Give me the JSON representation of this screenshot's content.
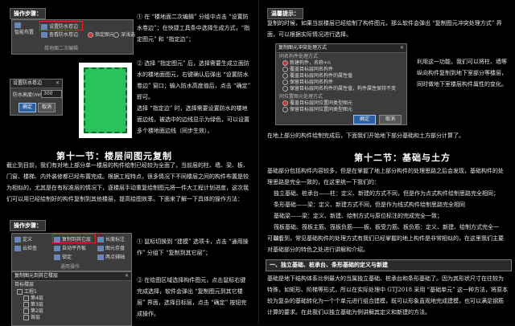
{
  "left": {
    "ops_header1": "操作步骤：",
    "toolbar1": {
      "btn_waterproof": "设置防水卷边",
      "btn_smart_layout": "智能布置",
      "btn_view_waterproof": "查看防水卷边",
      "chk_specify_element": "指定图元",
      "chk_select_ok": "深浅选",
      "group_label": "楼地面二次编辑"
    },
    "step1": "① 在 “楼地面二次编辑” 分组中点击 “设置防水卷边”；在快捷工具条中选择生成方式，“指定图元” 和 “指定边”；",
    "step2": "② 选择 “指定图元” 后，选择需要生成立面防水的楼地面图元，右键确认后弹出 “设置防水卷边” 窗口；输入防水高度值后，点击 “确定” 即可。",
    "step3": "选择 “指定边” 时，选择需要设置防水的楼地面边线，被选中的边线显示为绿色，可以设置多个楼地面边线（同步生效）。",
    "dialog1": {
      "title": "设置防水卷边",
      "label_height": "防水高度(mm)",
      "value": "300",
      "ok": "确定",
      "cancel": "取消"
    },
    "section11_title": "第十一节：楼层间图元复制",
    "section11_intro": "截止到目前，我们有对地上部分单一楼层的构件绘制已经较为全面了，当前层的柱、墙、梁、板、门窗、楼梯、内外装修都已经布置完成。根据工程特点，很多情况下不同楼层之间的构件布置是较为相似的，尤其是在有标准层的情况下，逐楼层手动重复绘制图元将一件大工程计划进度，这次我们可以用已经绘制好的构件复制到其他楼层，提高绘图效率。下面来了解一下具体的操作方法：",
    "ops_header2": "操作步骤：",
    "toolbar2": {
      "definition": "定义",
      "copy_to_layer": "复制到其它层",
      "length_dim": "长度标注",
      "cloud_check": "云检查",
      "auto_level_board": "自动平齐板",
      "image_management": "图元存盘",
      "lock": "锁定",
      "two_point_aux": "两点辅轴",
      "general_ops": "通用操作"
    },
    "dialog2": {
      "title": "复制图元到其它楼层",
      "header": "目标楼层",
      "root": "工程1",
      "layers": [
        "第4层",
        "第3层",
        "第2层",
        "首层",
        "基础层"
      ]
    },
    "step4": "① 鼠标切换到 “建模” 选项卡，点击 “通用操作” 分组下 “复制到其它层”；",
    "step5": "② 在绘图区域选择构件图元，点击鼠标右键完成选择，软件会弹出 “复制图元到其它楼层” 界面，选择目标层，点击 “确定” 按钮完成操作。"
  },
  "right": {
    "tips_header": "温馨提示：",
    "tips_text": "复制的时候，如果当前楼层已经绘制了构件图元，那么软件会弹出 “复制图元冲突处理方式” 界面，可以根据实际情况进行选择。",
    "dialog3": {
      "title": "复制图元冲突处理方式",
      "section1_title": "同名构件处理方式",
      "opt1": "新建构件，名称+n",
      "opt2": "覆盖目标层同名构件",
      "opt3": "覆盖目标层同名构件的属性值",
      "opt4": "保留目标层同名构件",
      "opt5": "保留目标层同名构件的属性值，构件属性保持不变",
      "section2_title": "同位置图元处理方式",
      "opt6": "覆盖目标层同位置同类型图元",
      "opt7": "保留目标层同位置同类型图元",
      "ok": "确定",
      "cancel": "取消"
    },
    "side_text": "利用这一功能，我们可以将柱、墙等纵向构件复制到地下室部分等楼层，同时做地下室楼层构件属性的变化。",
    "bottom_note": "在地上部分的构件绘制完成后，下面我们开始地下部分基础和土方部分计算了。",
    "section12_title": "第十二节：基础与土方",
    "section12_intro": "基础部分包括构件内容较多，但是在掌握了地上部分构件的处理思路之后会发现，基础构件的处理思路是完全一致的，在这里统一下我们的：",
    "line1": "独立基础、桩承台——柱：定义、新建的方式不同，但是作为点式构件绘制思路完全相同；",
    "line2": "条形基础——梁：定义、新建方式不同，但是作为线式构件绘制思路完全相同",
    "line3": "基础梁——梁：定义、新建、绘制方式与原位标注的完成完全一致；",
    "line4": "筏板基础、筏板主筋、筏板负筋——板、板受力筋、板负筋：定义、新建、绘制方式完全一致；",
    "line5": "可以看到，常见基础构件的处理方式有我们已经掌握的地上构件是非常相似的，在这里我们主要对基础部分的特色之处进行讲解和介绍。",
    "subheader": "一、独立基础、桩承台、条形基础的定义与新建",
    "last_para": "基础是地下结构体系比例最大的当属独立基础、桩承台和条形基础了。因为其形状尺寸在往较为特殊，如矩形、阶梯等形式，所以在实际处理中 GTJ2018 采用 “基础单元” 这一种方法，将原本较为复杂的基础转化为一个个单元进行组合建模，既可以形象直观地完成建模，也可以满足钢筋计算的要求。在此我们以独立基础为例讲解其定义和新建的方法。"
  }
}
